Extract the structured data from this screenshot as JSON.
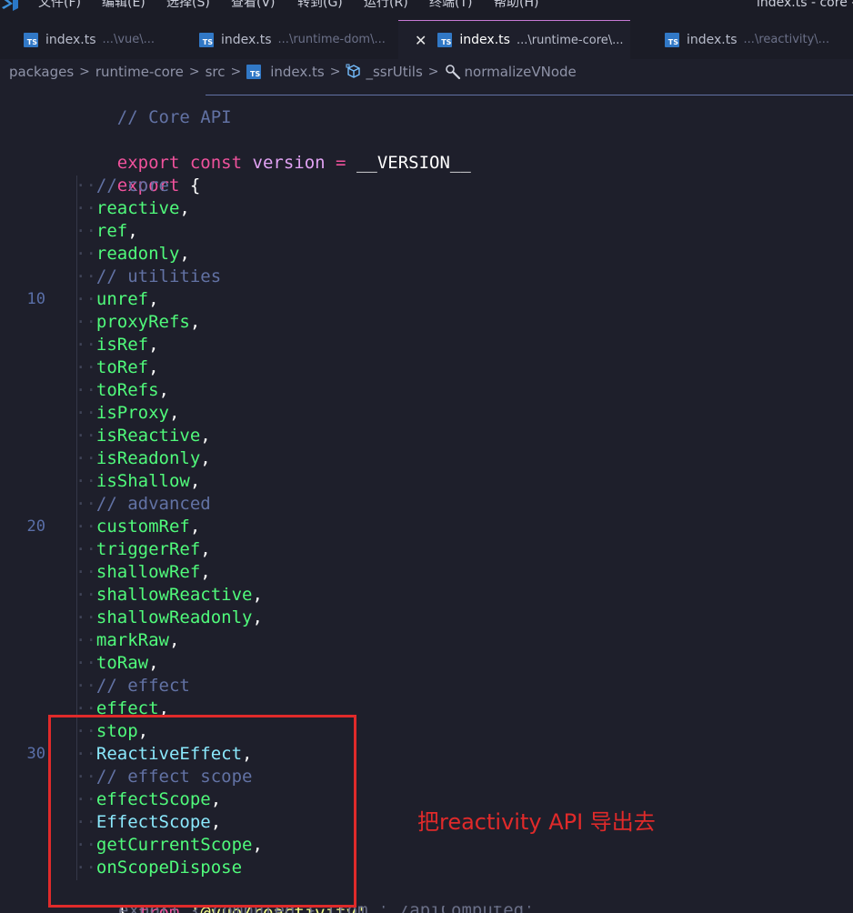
{
  "menubar": {
    "items": [
      "文件(F)",
      "编辑(E)",
      "选择(S)",
      "查看(V)",
      "转到(G)",
      "运行(R)",
      "终端(T)",
      "帮助(H)"
    ],
    "window_title": "index.ts - core -"
  },
  "tabs": [
    {
      "name": "index.ts",
      "path": "...\\vue\\..."
    },
    {
      "name": "index.ts",
      "path": "...\\runtime-dom\\..."
    },
    {
      "name": "index.ts",
      "path": "...\\runtime-core\\...",
      "active": true
    },
    {
      "name": "index.ts",
      "path": "...\\reactivity\\..."
    }
  ],
  "breadcrumb": {
    "items": [
      "packages",
      "runtime-core",
      "src",
      "index.ts",
      "_ssrUtils",
      "normalizeVNode"
    ]
  },
  "editor": {
    "line_numbers": {
      "l10": "10",
      "l20": "20",
      "l30": "30"
    },
    "header_comment": "// Core API",
    "version_line": {
      "kw1": "export",
      "kw2": "const",
      "name": "version",
      "op": "=",
      "value": "__VERSION__"
    },
    "export_open": {
      "kw": "export",
      "brace": "{"
    },
    "members": [
      {
        "type": "comment",
        "text": "// core"
      },
      {
        "type": "ident",
        "text": "reactive"
      },
      {
        "type": "ident",
        "text": "ref"
      },
      {
        "type": "ident",
        "text": "readonly"
      },
      {
        "type": "comment",
        "text": "// utilities"
      },
      {
        "type": "ident",
        "text": "unref"
      },
      {
        "type": "ident",
        "text": "proxyRefs"
      },
      {
        "type": "ident",
        "text": "isRef"
      },
      {
        "type": "ident",
        "text": "toRef"
      },
      {
        "type": "ident",
        "text": "toRefs"
      },
      {
        "type": "ident",
        "text": "isProxy"
      },
      {
        "type": "ident",
        "text": "isReactive"
      },
      {
        "type": "ident",
        "text": "isReadonly"
      },
      {
        "type": "ident",
        "text": "isShallow"
      },
      {
        "type": "comment",
        "text": "// advanced"
      },
      {
        "type": "ident",
        "text": "customRef"
      },
      {
        "type": "ident",
        "text": "triggerRef"
      },
      {
        "type": "ident",
        "text": "shallowRef"
      },
      {
        "type": "ident",
        "text": "shallowReactive"
      },
      {
        "type": "ident",
        "text": "shallowReadonly"
      },
      {
        "type": "ident",
        "text": "markRaw"
      },
      {
        "type": "ident",
        "text": "toRaw"
      },
      {
        "type": "comment",
        "text": "// effect"
      },
      {
        "type": "ident",
        "text": "effect"
      },
      {
        "type": "ident",
        "text": "stop"
      },
      {
        "type": "class",
        "text": "ReactiveEffect"
      },
      {
        "type": "comment",
        "text": "// effect scope"
      },
      {
        "type": "ident",
        "text": "effectScope"
      },
      {
        "type": "class",
        "text": "EffectScope"
      },
      {
        "type": "ident",
        "text": "getCurrentScope"
      },
      {
        "type": "ident",
        "text": "onScopeDispose",
        "last": true
      }
    ],
    "export_close": {
      "brace": "}",
      "kw": "from",
      "module": "'@vue/reactivity'"
    },
    "partial_next_line": "export { computed } from './apiComputed'"
  },
  "annotation": {
    "text": "把reactivity API 导出去",
    "color": "#e02a2a"
  }
}
